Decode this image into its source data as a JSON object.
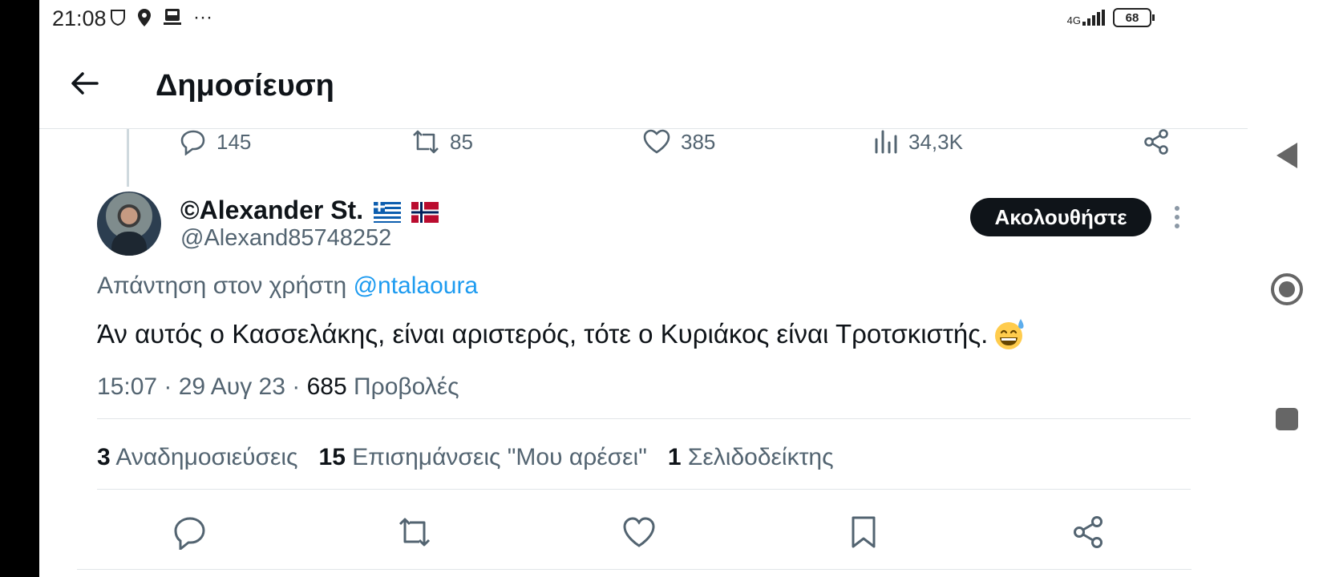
{
  "status_bar": {
    "time": "21:08",
    "icons": [
      "shield-icon",
      "location-icon",
      "train-icon",
      "more-dots-icon"
    ],
    "more": "···",
    "network": "4G",
    "battery": "68"
  },
  "header": {
    "back_icon": "arrow-left-icon",
    "title": "Δημοσίευση"
  },
  "parent_metrics": {
    "replies": "145",
    "reposts": "85",
    "likes": "385",
    "views": "34,3K"
  },
  "tweet": {
    "display_name": "©Alexander St.",
    "handle": "@Alexand85748252",
    "follow_label": "Ακολουθήστε",
    "reply_prefix": "Απάντηση στον χρήστη",
    "reply_mention": "@ntalaoura",
    "text": "Άν αυτός ο Κασσελάκης, είναι αριστερός, τότε ο Κυριάκος είναι Τροτσκιστής.",
    "timestamp": "15:07 · 29 Αυγ 23 ·",
    "views_count": "685",
    "views_label": "Προβολές"
  },
  "stats": {
    "reposts_count": "3",
    "reposts_label": "Αναδημοσιεύσεις",
    "likes_count": "15",
    "likes_label": "Επισημάνσεις \"Μου αρέσει\"",
    "bookmarks_count": "1",
    "bookmarks_label": "Σελιδοδείκτης"
  },
  "colors": {
    "text": "#0f1419",
    "muted": "#536471",
    "link": "#1d9bf0",
    "divider": "#e1e5e8"
  }
}
